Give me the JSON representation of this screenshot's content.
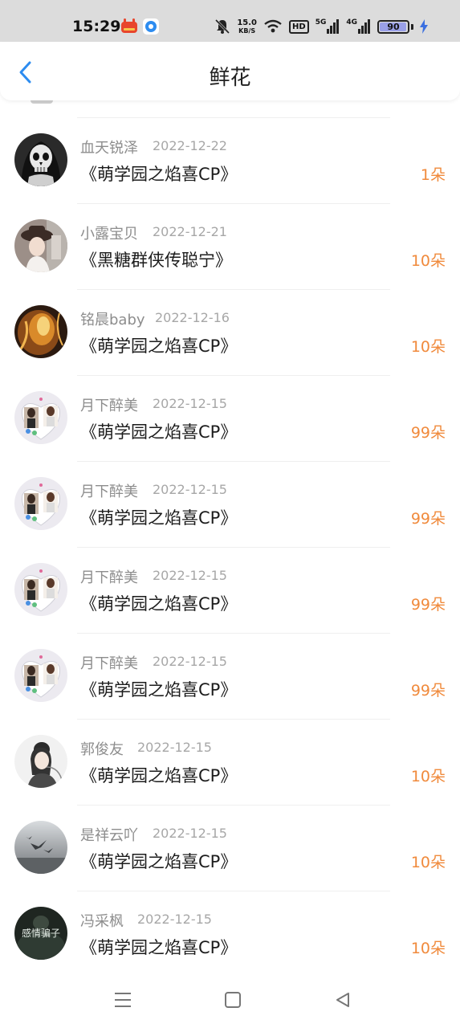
{
  "status_bar": {
    "time": "15:29",
    "network_speed_value": "15.0",
    "network_speed_unit": "KB/S",
    "hd_badge": "HD",
    "signal1_label": "5G",
    "signal2_label": "4G",
    "battery": "90",
    "battery_level": 0.9
  },
  "header": {
    "title": "鲜花",
    "back_icon": "chevron-left-icon"
  },
  "colors": {
    "accent_blue": "#2d8cf0",
    "count_orange": "#f08a3c"
  },
  "records": [
    {
      "name": "血天锐泽",
      "date": "2022-12-22",
      "book": "《萌学园之焰喜CP》",
      "count": "1朵",
      "avatar": "skull-avatar"
    },
    {
      "name": "小露宝贝",
      "date": "2022-12-21",
      "book": "《黑糖群侠传聪宁》",
      "count": "10朵",
      "avatar": "girl-hat-avatar"
    },
    {
      "name": "铭晨baby",
      "date": "2022-12-16",
      "book": "《萌学园之焰喜CP》",
      "count": "10朵",
      "avatar": "fire-avatar"
    },
    {
      "name": "月下醉美",
      "date": "2022-12-15",
      "book": "《萌学园之焰喜CP》",
      "count": "99朵",
      "avatar": "couple-photo-avatar"
    },
    {
      "name": "月下醉美",
      "date": "2022-12-15",
      "book": "《萌学园之焰喜CP》",
      "count": "99朵",
      "avatar": "couple-photo-avatar"
    },
    {
      "name": "月下醉美",
      "date": "2022-12-15",
      "book": "《萌学园之焰喜CP》",
      "count": "99朵",
      "avatar": "couple-photo-avatar"
    },
    {
      "name": "月下醉美",
      "date": "2022-12-15",
      "book": "《萌学园之焰喜CP》",
      "count": "99朵",
      "avatar": "couple-photo-avatar"
    },
    {
      "name": "郭俊友",
      "date": "2022-12-15",
      "book": "《萌学园之焰喜CP》",
      "count": "10朵",
      "avatar": "ink-girl-avatar"
    },
    {
      "name": "是祥云吖",
      "date": "2022-12-15",
      "book": "《萌学园之焰喜CP》",
      "count": "10朵",
      "avatar": "birds-avatar"
    },
    {
      "name": "冯采枫",
      "date": "2022-12-15",
      "book": "《萌学园之焰喜CP》",
      "count": "10朵",
      "avatar": "dark-text-avatar",
      "avatar_text": "感情骗子"
    }
  ],
  "nav_bar": {
    "menu_icon": "menu-lines-icon",
    "home_icon": "home-square-icon",
    "back_icon": "back-triangle-icon"
  }
}
